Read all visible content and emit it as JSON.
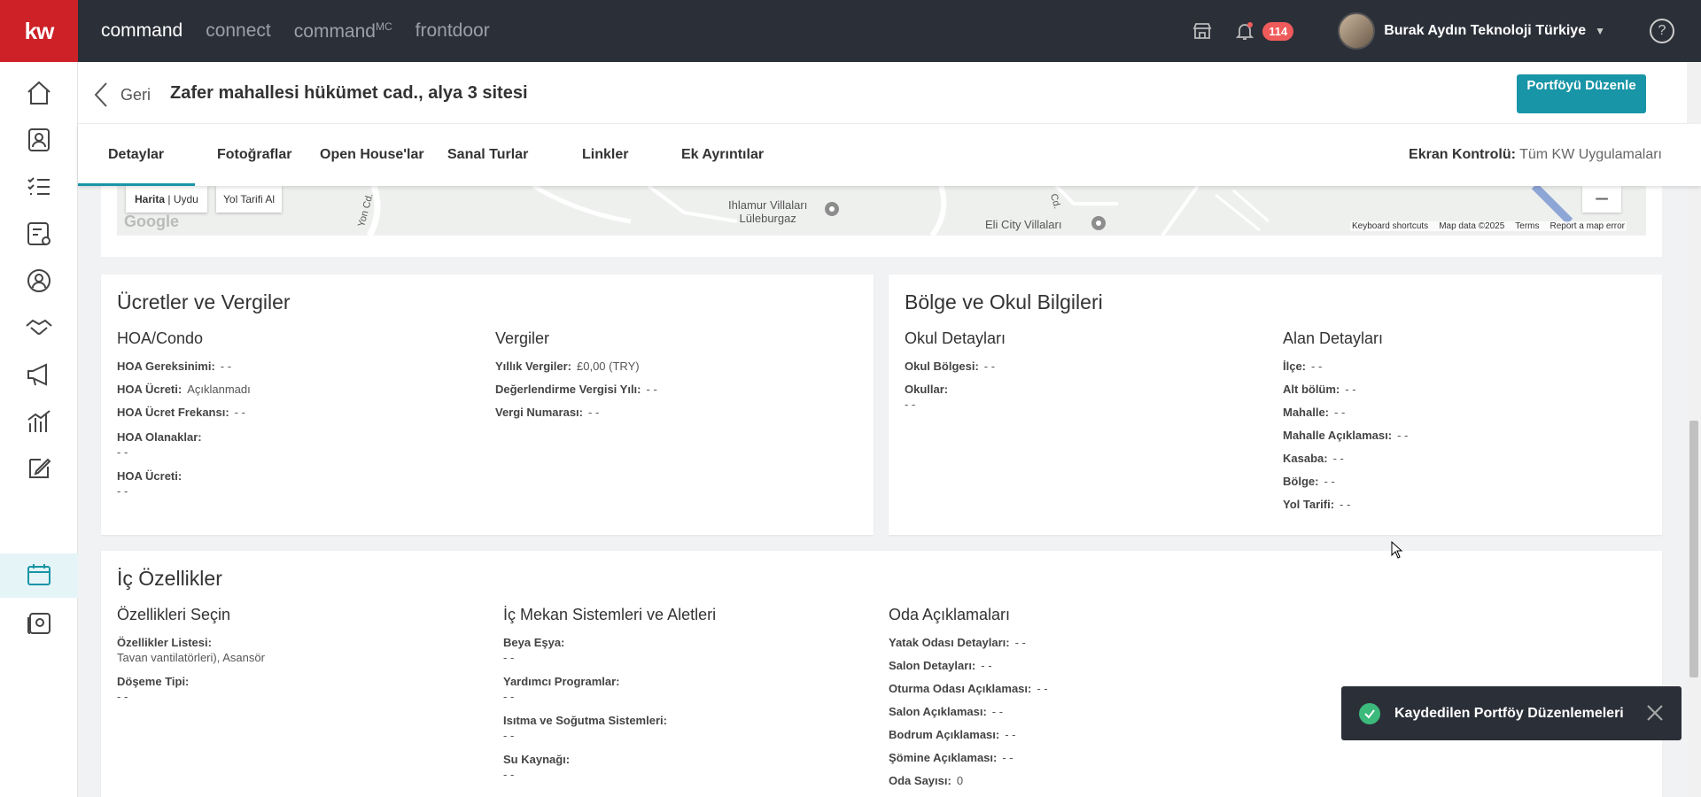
{
  "topbar": {
    "logo": "kw",
    "nav": [
      {
        "label": "command",
        "sup": "",
        "active": true
      },
      {
        "label": "connect",
        "sup": "",
        "active": false
      },
      {
        "label": "command",
        "sup": "MC",
        "active": false
      },
      {
        "label": "frontdoor",
        "sup": "",
        "active": false
      }
    ],
    "notif_count": "114",
    "user_name": "Burak Aydın Teknoloji Türkiye",
    "help": "?"
  },
  "subheader": {
    "back_label": "Geri",
    "title": "Zafer mahallesi hükümet cad., alya 3 sitesi",
    "edit_button": "Portföyü Düzenle"
  },
  "tabs": [
    "Detaylar",
    "Fotoğraflar",
    "Open House'lar",
    "Sanal Turlar",
    "Linkler",
    "Ek Ayrıntılar"
  ],
  "screen_control": {
    "label": "Ekran Kontrolü:",
    "value": "Tüm KW Uygulamaları"
  },
  "map": {
    "toggle_map": "Harita",
    "toggle_sat": "Uydu",
    "directions": "Yol Tarifi Al",
    "google": "Google",
    "labels": [
      "Ihlamur Villaları",
      "Lüleburgaz",
      "Eli City Villaları",
      "Yon Cd.",
      "Cd."
    ],
    "footer": [
      "Keyboard shortcuts",
      "Map data ©2025",
      "Terms",
      "Report a map error"
    ],
    "zoom_out": "−"
  },
  "fees": {
    "title": "Ücretler ve Vergiler",
    "hoa_title": "HOA/Condo",
    "hoa": [
      {
        "label": "HOA Gereksinimi:",
        "value": "- -"
      },
      {
        "label": "HOA Ücreti:",
        "value": "Açıklanmadı"
      },
      {
        "label": "HOA Ücret Frekansı:",
        "value": "- -"
      },
      {
        "label": "HOA Olanaklar:",
        "value": "- -"
      },
      {
        "label": "HOA Ücreti:",
        "value": "- -"
      }
    ],
    "tax_title": "Vergiler",
    "tax": [
      {
        "label": "Yıllık Vergiler:",
        "value": "£0,00 (TRY)"
      },
      {
        "label": "Değerlendirme Vergisi Yılı:",
        "value": "- -"
      },
      {
        "label": "Vergi Numarası:",
        "value": "- -"
      }
    ]
  },
  "region": {
    "title": "Bölge ve Okul Bilgileri",
    "school_title": "Okul Detayları",
    "school": [
      {
        "label": "Okul Bölgesi:",
        "value": "- -"
      },
      {
        "label": "Okullar:",
        "value": "- -"
      }
    ],
    "area_title": "Alan Detayları",
    "area": [
      {
        "label": "İlçe:",
        "value": "- -"
      },
      {
        "label": "Alt bölüm:",
        "value": "- -"
      },
      {
        "label": "Mahalle:",
        "value": "- -"
      },
      {
        "label": "Mahalle Açıklaması:",
        "value": "- -"
      },
      {
        "label": "Kasaba:",
        "value": "- -"
      },
      {
        "label": "Bölge:",
        "value": "- -"
      },
      {
        "label": "Yol Tarifi:",
        "value": "- -"
      }
    ]
  },
  "interior": {
    "title": "İç Özellikler",
    "features_title": "Özellikleri Seçin",
    "features": [
      {
        "label": "Özellikler Listesi:",
        "value": "Tavan vantilatörleri), Asansör"
      },
      {
        "label": "Döşeme Tipi:",
        "value": "- -"
      }
    ],
    "systems_title": "İç Mekan Sistemleri ve Aletleri",
    "systems": [
      {
        "label": "Beya Eşya:",
        "value": "- -"
      },
      {
        "label": "Yardımcı Programlar:",
        "value": "- -"
      },
      {
        "label": "Isıtma ve Soğutma Sistemleri:",
        "value": "- -"
      },
      {
        "label": "Su Kaynağı:",
        "value": "- -"
      }
    ],
    "rooms_title": "Oda Açıklamaları",
    "rooms": [
      {
        "label": "Yatak Odası Detayları:",
        "value": "- -"
      },
      {
        "label": "Salon Detayları:",
        "value": "- -"
      },
      {
        "label": "Oturma Odası Açıklaması:",
        "value": "- -"
      },
      {
        "label": "Salon Açıklaması:",
        "value": "- -"
      },
      {
        "label": "Bodrum Açıklaması:",
        "value": "- -"
      },
      {
        "label": "Şömine Açıklaması:",
        "value": "- -"
      },
      {
        "label": "Oda Sayısı:",
        "value": "0"
      }
    ]
  },
  "toast": {
    "message": "Kaydedilen Portföy Düzenlemeleri"
  },
  "colors": {
    "brand_red": "#cd2027",
    "teal": "#1895a6",
    "dark": "#2b2f38",
    "success": "#3cba7b",
    "badge": "#ef5b5b"
  }
}
